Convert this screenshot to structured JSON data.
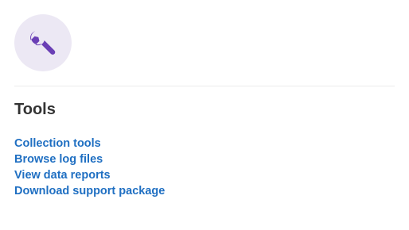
{
  "card": {
    "icon": "wrench-icon",
    "icon_color": "#6a3fb5",
    "icon_bg": "#ece8f4",
    "title": "Tools",
    "link_color": "#1f6fc2",
    "links": [
      {
        "label": "Collection tools"
      },
      {
        "label": "Browse log files"
      },
      {
        "label": "View data reports"
      },
      {
        "label": "Download support package"
      }
    ]
  }
}
